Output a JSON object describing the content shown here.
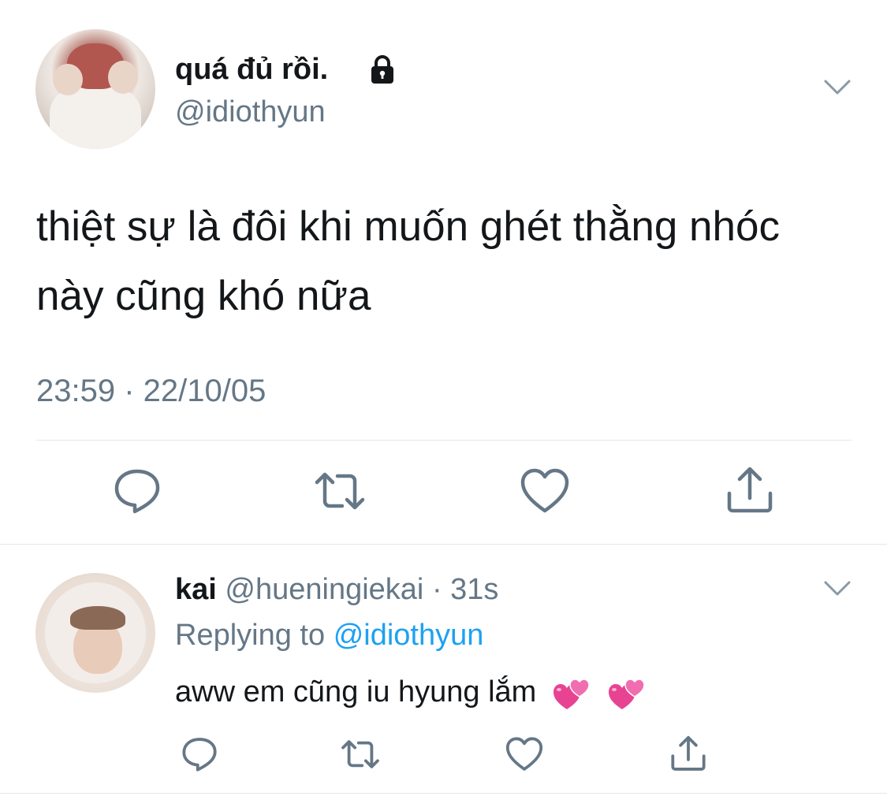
{
  "main_tweet": {
    "display_name": "quá đủ rồi.",
    "protected_icon": "lock-icon",
    "username": "@idiothyun",
    "text": "thiệt sự là đôi khi muốn ghét thằng nhóc này cũng khó nữa",
    "timestamp": "23:59 · 22/10/05",
    "menu_icon": "chevron-down-icon",
    "actions": [
      "reply-icon",
      "retweet-icon",
      "like-icon",
      "share-icon"
    ]
  },
  "reply_tweet": {
    "display_name": "kai",
    "username": "@hueningiekai",
    "separator": "·",
    "time_ago": "31s",
    "replying_label": "Replying to",
    "replying_mention": "@idiothyun",
    "text": "aww em cũng iu hyung lắm",
    "emoji": [
      "two-hearts-emoji",
      "two-hearts-emoji"
    ],
    "menu_icon": "chevron-down-icon",
    "actions": [
      "reply-icon",
      "retweet-icon",
      "like-icon",
      "share-icon"
    ]
  },
  "colors": {
    "text_primary": "#14171a",
    "text_secondary": "#657786",
    "link": "#1da1f2",
    "divider": "#e1e8ed",
    "icon": "#657786",
    "heart_emoji": "#e84393"
  }
}
